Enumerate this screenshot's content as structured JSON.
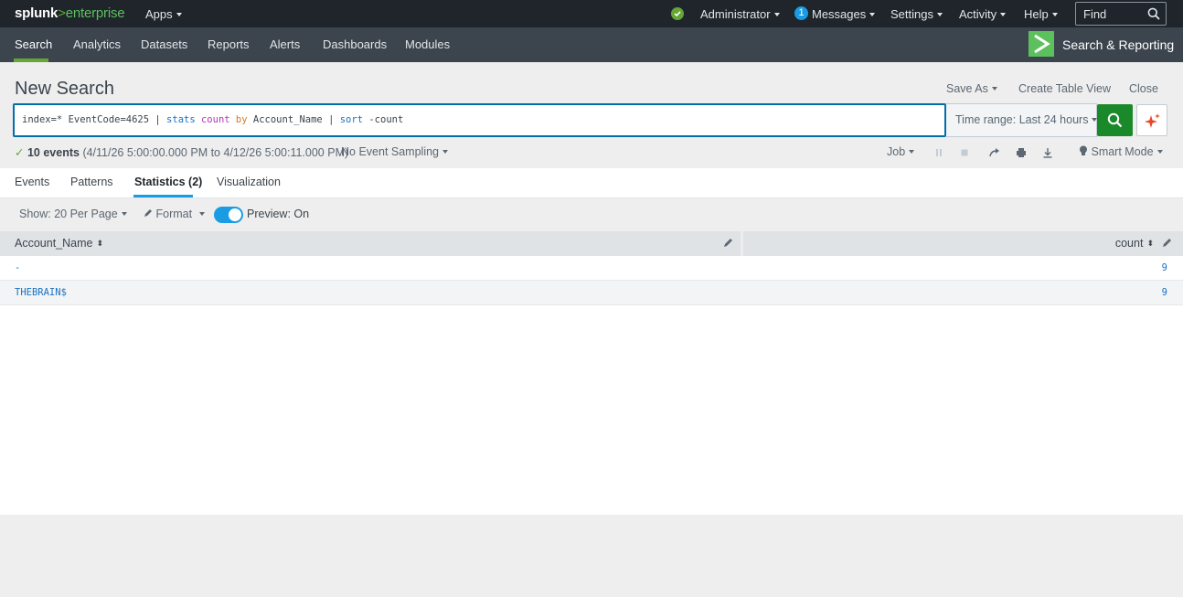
{
  "topbar": {
    "logo_part1": "splunk",
    "logo_part2": ">",
    "logo_part3": "enterprise",
    "apps": "Apps",
    "user": "Administrator",
    "messages_count": "1",
    "messages": "Messages",
    "settings": "Settings",
    "activity": "Activity",
    "help": "Help",
    "find_placeholder": "Find"
  },
  "nav": {
    "items": [
      "Search",
      "Analytics",
      "Datasets",
      "Reports",
      "Alerts",
      "Dashboards",
      "Modules"
    ],
    "active": "Search",
    "app_title": "Search & Reporting"
  },
  "header": {
    "title": "New Search",
    "save_as": "Save As",
    "create_table_view": "Create Table View",
    "close": "Close"
  },
  "search": {
    "query_parts": [
      {
        "text": "index=* EventCode=4625 | ",
        "kind": "plain"
      },
      {
        "text": "stats",
        "kind": "cmd"
      },
      {
        "text": " ",
        "kind": "plain"
      },
      {
        "text": "count",
        "kind": "fn"
      },
      {
        "text": " ",
        "kind": "plain"
      },
      {
        "text": "by",
        "kind": "kw"
      },
      {
        "text": " Account_Name | ",
        "kind": "plain"
      },
      {
        "text": "sort",
        "kind": "cmd"
      },
      {
        "text": " -count",
        "kind": "plain"
      }
    ],
    "time_range": "Time range: Last 24 hours"
  },
  "status": {
    "check": "✓",
    "events": "10 events",
    "range": "(4/11/26 5:00:00.000 PM to 4/12/26 5:00:11.000 PM)",
    "sampling": "No Event Sampling",
    "job": "Job",
    "mode": "Smart Mode"
  },
  "tabs": {
    "events": "Events",
    "patterns": "Patterns",
    "statistics": "Statistics (2)",
    "visualization": "Visualization"
  },
  "controls": {
    "show": "Show: 20 Per Page",
    "format": "Format",
    "preview": "Preview: On"
  },
  "table": {
    "columns": [
      "Account_Name",
      "count"
    ],
    "rows": [
      [
        "-",
        "9"
      ],
      [
        "THEBRAIN$",
        "9"
      ]
    ]
  },
  "colors": {
    "accent_green": "#65a637",
    "link_blue": "#1a72c2",
    "search_border": "#006eaa",
    "search_button": "#1a8929",
    "toggle_blue": "#1a9ce5"
  }
}
